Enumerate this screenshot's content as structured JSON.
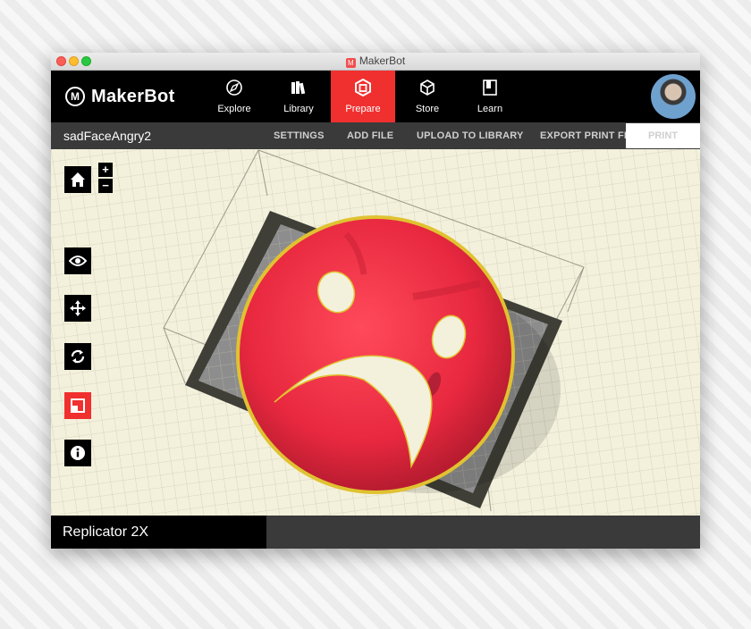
{
  "window": {
    "title": "MakerBot"
  },
  "brand": {
    "logo_text": "MakerBot",
    "logo_mark": "M"
  },
  "nav": {
    "items": [
      {
        "label": "Explore",
        "icon": "compass-icon"
      },
      {
        "label": "Library",
        "icon": "books-icon"
      },
      {
        "label": "Prepare",
        "icon": "prepare-box-icon",
        "active": true
      },
      {
        "label": "Store",
        "icon": "cube-icon"
      },
      {
        "label": "Learn",
        "icon": "book-icon"
      }
    ]
  },
  "toolbar": {
    "file_name": "sadFaceAngry2",
    "settings": "SETTINGS",
    "add_file": "ADD FILE",
    "upload": "UPLOAD TO LIBRARY",
    "export": "EXPORT PRINT FILE",
    "print": "PRINT"
  },
  "zoom": {
    "in": "+",
    "out": "−"
  },
  "side_tools": [
    "home-icon",
    "eye-icon",
    "move-icon",
    "rotate-icon",
    "scale-icon",
    "info-icon"
  ],
  "status": {
    "printer": "Replicator 2X"
  },
  "colors": {
    "accent": "#f0302f",
    "model": "#e8283f",
    "bed": "#f3f1dc"
  }
}
